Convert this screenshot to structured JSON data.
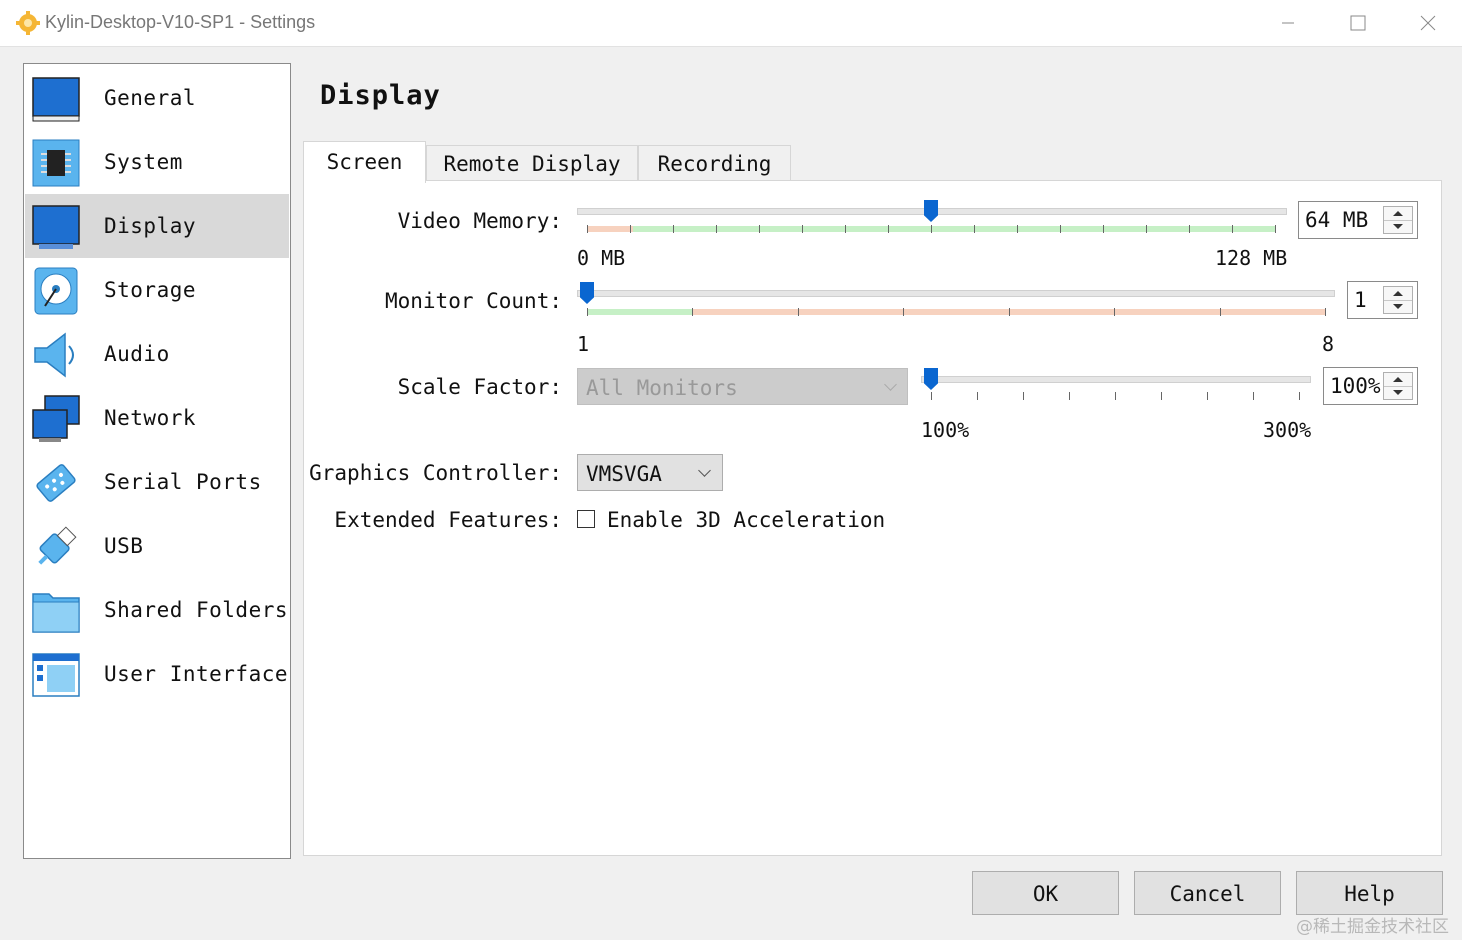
{
  "window": {
    "title": "Kylin-Desktop-V10-SP1 - Settings",
    "controls": [
      "minimize",
      "maximize",
      "close"
    ]
  },
  "sidebar": {
    "items": [
      {
        "label": "General",
        "icon": "general-icon"
      },
      {
        "label": "System",
        "icon": "system-chip-icon"
      },
      {
        "label": "Display",
        "icon": "display-monitor-icon",
        "selected": true
      },
      {
        "label": "Storage",
        "icon": "storage-disk-icon"
      },
      {
        "label": "Audio",
        "icon": "audio-speaker-icon"
      },
      {
        "label": "Network",
        "icon": "network-icon"
      },
      {
        "label": "Serial Ports",
        "icon": "serial-port-icon"
      },
      {
        "label": "USB",
        "icon": "usb-icon"
      },
      {
        "label": "Shared Folders",
        "icon": "shared-folder-icon"
      },
      {
        "label": "User Interface",
        "icon": "user-interface-icon"
      }
    ]
  },
  "main": {
    "title": "Display",
    "tabs": [
      {
        "label": "Screen",
        "active": true
      },
      {
        "label": "Remote Display"
      },
      {
        "label": "Recording"
      }
    ],
    "screen": {
      "video_memory": {
        "label": "Video Memory:",
        "value": "64 MB",
        "min_label": "0 MB",
        "max_label": "128 MB",
        "level": 0.5
      },
      "monitor_count": {
        "label": "Monitor Count:",
        "value": "1",
        "min_label": "1",
        "max_label": "8",
        "level": 0.0
      },
      "scale_factor": {
        "label": "Scale Factor:",
        "combo": "All Monitors",
        "value": "100%",
        "min_label": "100%",
        "max_label": "300%",
        "level": 0.0
      },
      "graphics_controller": {
        "label": "Graphics Controller:",
        "value": "VMSVGA"
      },
      "extended_features": {
        "label": "Extended Features:",
        "checkbox_label": "Enable 3D Acceleration",
        "checked": false
      }
    }
  },
  "buttons": {
    "ok": "OK",
    "cancel": "Cancel",
    "help": "Help"
  },
  "watermark": "@稀土掘金技术社区",
  "colors": {
    "accent": "#0a66d0",
    "green_zone": "#c6f0c6",
    "orange_zone": "#f7d2bf",
    "selected_bg": "#d9d9d9"
  }
}
